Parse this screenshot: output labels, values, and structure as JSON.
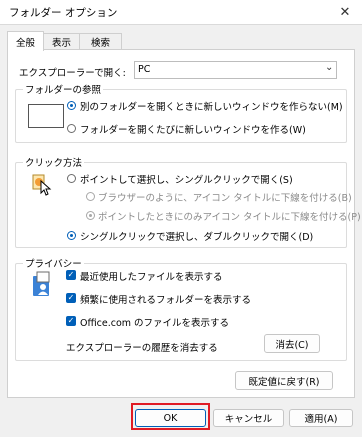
{
  "window": {
    "title": "フォルダー オプション",
    "close_glyph": "✕"
  },
  "tabs": [
    {
      "label": "全般",
      "active": true
    },
    {
      "label": "表示",
      "active": false
    },
    {
      "label": "検索",
      "active": false
    }
  ],
  "open_explorer": {
    "label": "エクスプローラーで開く:",
    "value": "PC"
  },
  "browse_folders": {
    "title": "フォルダーの参照",
    "options": [
      {
        "label": "別のフォルダーを開くときに新しいウィンドウを作らない(M)",
        "checked": true
      },
      {
        "label": "フォルダーを開くたびに新しいウィンドウを作る(W)",
        "checked": false
      }
    ]
  },
  "click_method": {
    "title": "クリック方法",
    "single_click": {
      "label": "ポイントして選択し、シングルクリックで開く(S)",
      "checked": false
    },
    "underline_options": [
      {
        "label": "ブラウザーのように、アイコン タイトルに下線を付ける(B)",
        "checked": false
      },
      {
        "label": "ポイントしたときにのみアイコン タイトルに下線を付ける(P)",
        "checked": true
      }
    ],
    "double_click": {
      "label": "シングルクリックで選択し、ダブルクリックで開く(D)",
      "checked": true
    }
  },
  "privacy": {
    "title": "プライバシー",
    "checkboxes": [
      {
        "label": "最近使用したファイルを表示する",
        "checked": true
      },
      {
        "label": "頻繁に使用されるフォルダーを表示する",
        "checked": true
      },
      {
        "label": "Office.com のファイルを表示する",
        "checked": true
      }
    ],
    "history_label": "エクスプローラーの履歴を消去する",
    "clear_button": "消去(C)"
  },
  "restore_defaults_button": "既定値に戻す(R)",
  "footer": {
    "ok": "OK",
    "cancel": "キャンセル",
    "apply": "適用(A)"
  },
  "colors": {
    "accent": "#005fb8",
    "highlight_outline": "#e01b24"
  }
}
